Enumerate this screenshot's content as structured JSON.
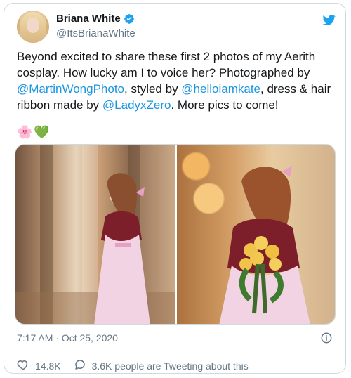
{
  "tweet": {
    "name": "Briana White",
    "handle": "@ItsBrianaWhite",
    "text_parts": [
      "Beyond excited to share these first 2 photos of my Aerith cosplay. How lucky am I to voice her? Photographed by ",
      "@MartinWongPhoto",
      ", styled by ",
      "@helloiamkate",
      ", dress & hair ribbon made by ",
      "@LadyxZero",
      ". More pics to come!"
    ],
    "emojis": [
      "🌸",
      "💚"
    ],
    "timestamp": "7:17 AM · Oct 25, 2020",
    "likes": "14.8K",
    "tweeting_about": "3.6K people are Tweeting about this",
    "colors": {
      "link": "#1b95e0",
      "verified": "#1da1f2",
      "twitter": "#1da1f2",
      "muted": "#657786"
    },
    "icons": [
      "verified-badge-icon",
      "twitter-bird-icon",
      "info-icon",
      "like-heart-icon",
      "reply-bubble-icon"
    ]
  }
}
